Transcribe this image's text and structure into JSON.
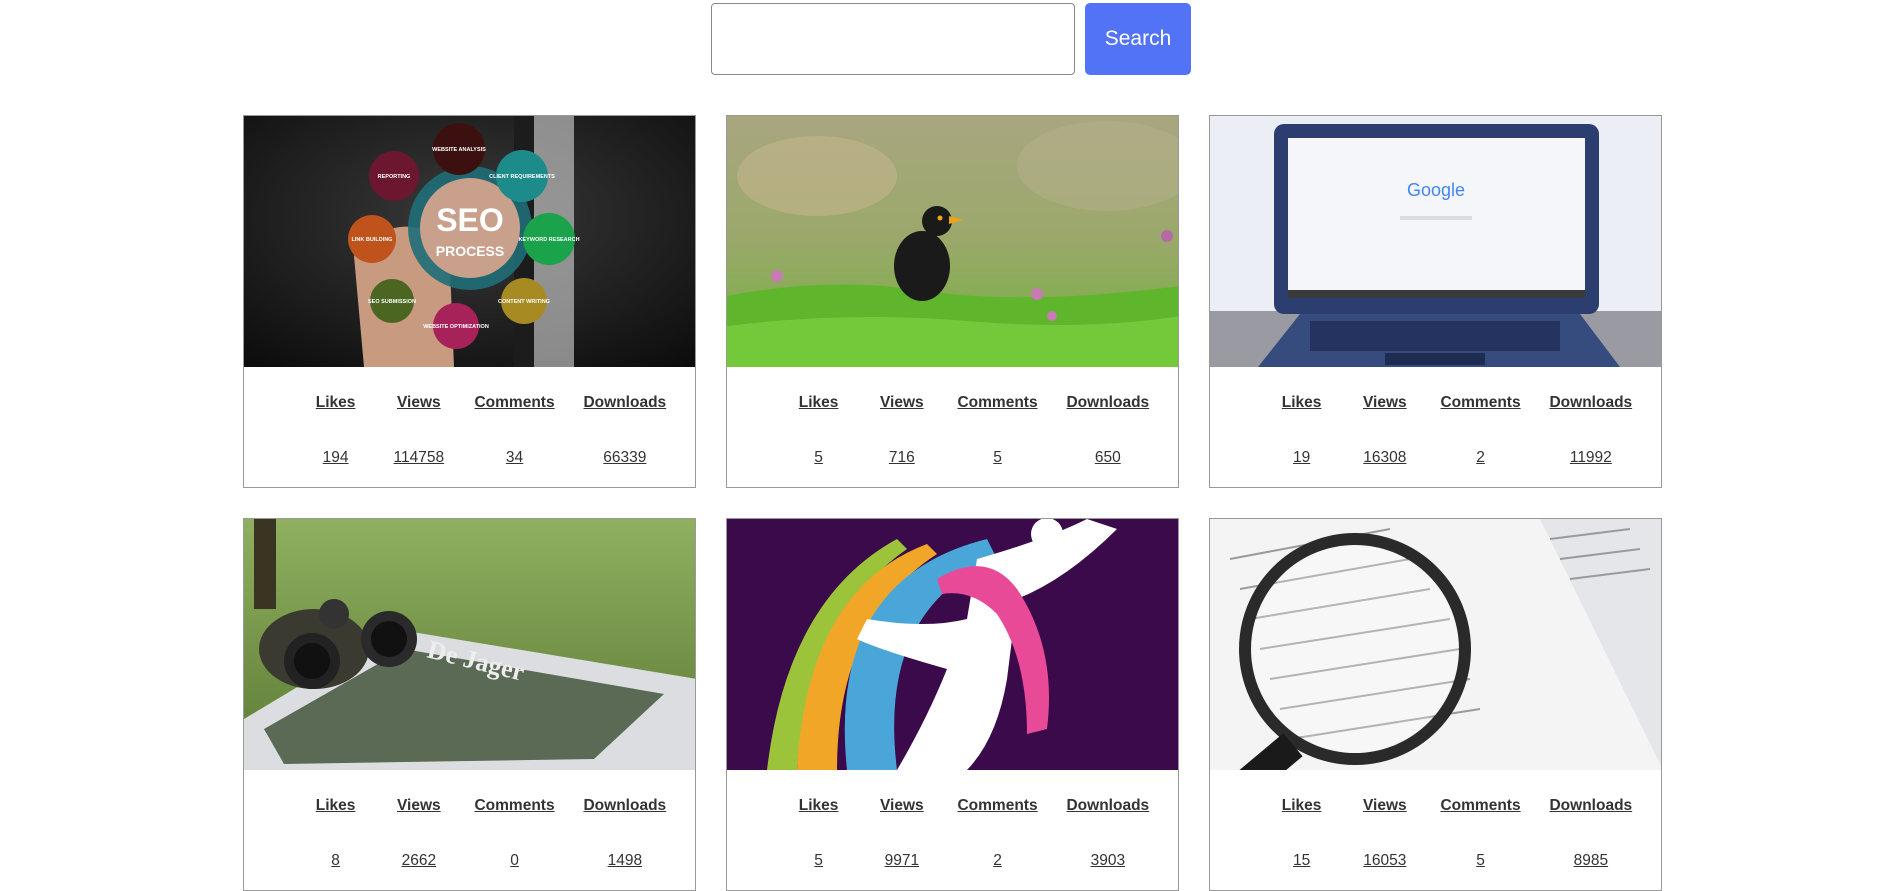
{
  "search": {
    "value": "",
    "placeholder": "",
    "button_label": "Search",
    "button_color": "#5273f5"
  },
  "stat_labels": {
    "likes": "Likes",
    "views": "Views",
    "comments": "Comments",
    "downloads": "Downloads"
  },
  "images": [
    {
      "subject": "seo-process-hand",
      "graphic_text": [
        "SEO",
        "PROCESS",
        "WEBSITE ANALYSIS",
        "CLIENT REQUIREMENTS",
        "KEYWORD RESEARCH",
        "CONTENT WRITING",
        "WEBSITE OPTIMIZATION",
        "SEO SUBMISSION",
        "LINK BUILDING",
        "REPORTING"
      ],
      "likes": "194",
      "views": "114758",
      "comments": "34",
      "downloads": "66339"
    },
    {
      "subject": "blackbird-in-grass",
      "likes": "5",
      "views": "716",
      "comments": "5",
      "downloads": "650"
    },
    {
      "subject": "laptop-google",
      "graphic_text": [
        "Google"
      ],
      "likes": "19",
      "views": "16308",
      "comments": "2",
      "downloads": "11992"
    },
    {
      "subject": "binoculars-magazine",
      "graphic_text": [
        "De Jager"
      ],
      "likes": "8",
      "views": "2662",
      "comments": "0",
      "downloads": "1498"
    },
    {
      "subject": "abstract-dancer-ribbons",
      "likes": "5",
      "views": "9971",
      "comments": "2",
      "downloads": "3903"
    },
    {
      "subject": "magnifying-glass-document",
      "likes": "15",
      "views": "16053",
      "comments": "5",
      "downloads": "8985"
    }
  ]
}
